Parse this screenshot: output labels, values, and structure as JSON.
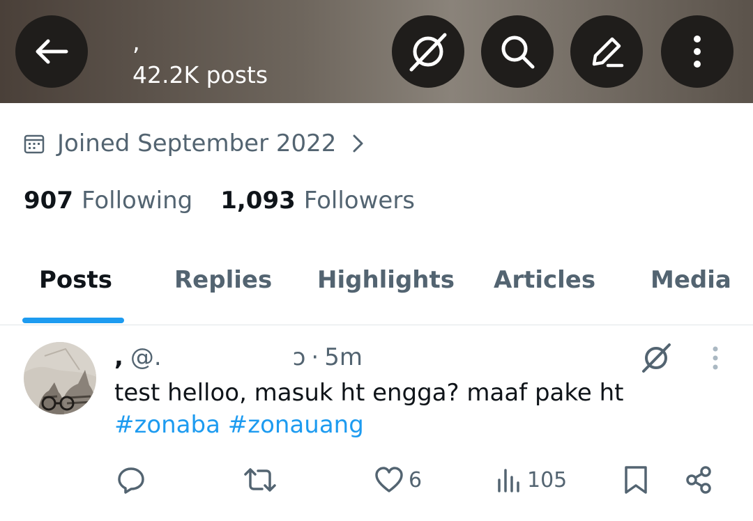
{
  "header": {
    "title": ",",
    "posts_count": "42.2K posts"
  },
  "profile": {
    "joined": "Joined September 2022",
    "following_count": "907",
    "following_label": "Following",
    "followers_count": "1,093",
    "followers_label": "Followers"
  },
  "tabs": [
    {
      "label": "Posts",
      "active": true
    },
    {
      "label": "Replies",
      "active": false
    },
    {
      "label": "Highlights",
      "active": false
    },
    {
      "label": "Articles",
      "active": false
    },
    {
      "label": "Media",
      "active": false
    }
  ],
  "post": {
    "display_name": ",",
    "handle_prefix": "@.",
    "handle_suffix": "ɔ",
    "separator": "·",
    "time": "5m",
    "text": "test helloo, masuk ht engga? maaf pake ht",
    "hashtags": [
      "#zonaba",
      "#zonauang"
    ],
    "likes": "6",
    "views": "105"
  },
  "colors": {
    "accent": "#1d9bf0",
    "text_primary": "#0f1419",
    "text_secondary": "#536471",
    "header_button": "#1f1d1b"
  }
}
